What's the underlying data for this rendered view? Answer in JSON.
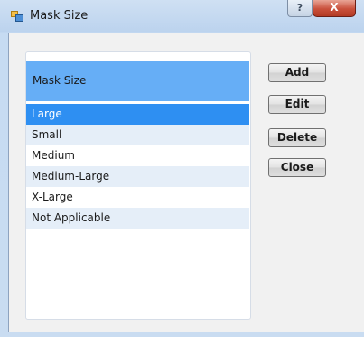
{
  "window": {
    "title": "Mask Size",
    "help_glyph": "?",
    "close_glyph": "X"
  },
  "list": {
    "header": "Mask Size",
    "items": [
      {
        "label": "Large",
        "selected": true
      },
      {
        "label": "Small",
        "selected": false
      },
      {
        "label": "Medium",
        "selected": false
      },
      {
        "label": "Medium-Large",
        "selected": false
      },
      {
        "label": "X-Large",
        "selected": false
      },
      {
        "label": "Not Applicable",
        "selected": false
      }
    ]
  },
  "buttons": {
    "add": "Add",
    "edit": "Edit",
    "delete": "Delete",
    "close": "Close"
  },
  "colors": {
    "header_bg": "#66aef6",
    "selected_bg": "#2e8ff2",
    "alt_row_bg": "#e5eef8"
  }
}
